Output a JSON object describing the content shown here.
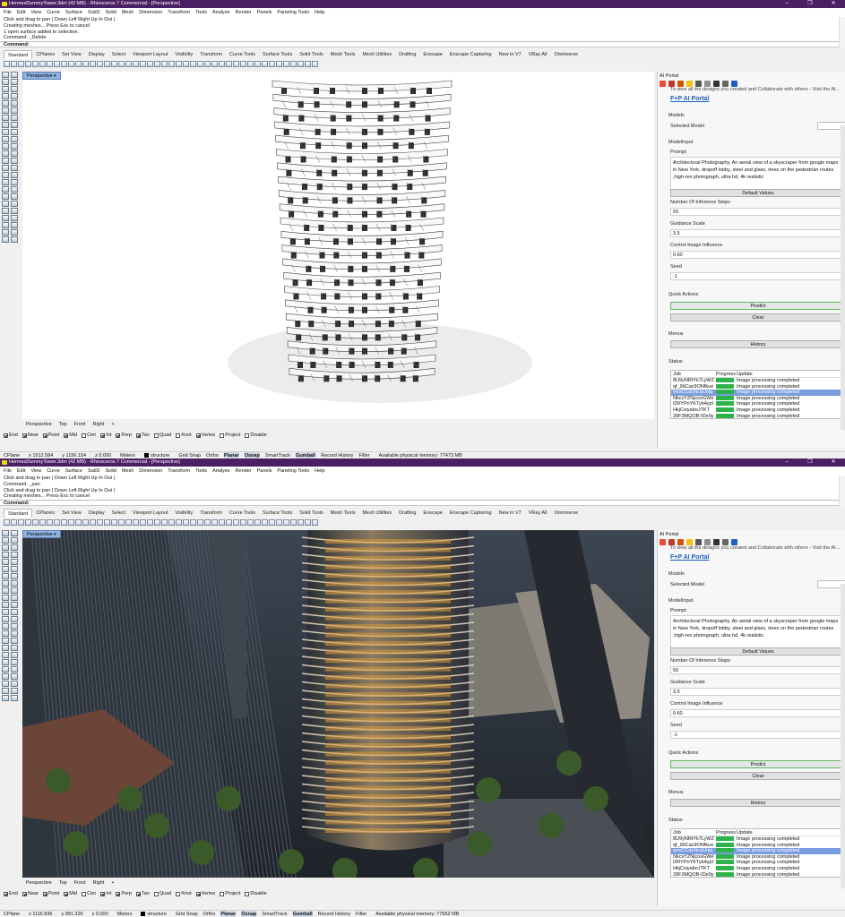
{
  "screens": [
    {
      "window_title": "HermesDummyTower.3dm (42 MB) - Rhinoceros 7 Commercial - [Perspective]",
      "command_history": [
        "Click and drag to pan ( Down  Left  Right  Up  In  Out )",
        "Creating meshes... Press Esc to cancel",
        "1 open surface added to selection.",
        "Command: _Delete"
      ],
      "command_prompt": "Command:",
      "viewport_label": "Perspective",
      "viewport_content": "wireframe",
      "status": {
        "cplane": "CPlane",
        "x": "x 1512.584",
        "y": "y 1156.154",
        "z": "z 0.000",
        "units": "Meters",
        "layer": "structure",
        "memory": "Available physical memory: 77473 MB"
      }
    },
    {
      "window_title": "HermesDummyTower.3dm (42 MB) - Rhinoceros 7 Commercial - [Perspective]",
      "command_history": [
        "Click and drag to pan ( Down  Left  Right  Up  In  Out )",
        "Command: _pan",
        "Click and drag to pan ( Down  Left  Right  Up  In  Out )",
        "Creating meshes... Press Esc to cancel"
      ],
      "command_prompt": "Command:",
      "viewport_label": "Perspective",
      "viewport_content": "render",
      "status": {
        "cplane": "CPlane",
        "x": "x 1116.836",
        "y": "y 991.326",
        "z": "z 0.000",
        "units": "Meters",
        "layer": "structure",
        "memory": "Available physical memory: 77552 MB"
      }
    }
  ],
  "menu": [
    "File",
    "Edit",
    "View",
    "Curve",
    "Surface",
    "SubD",
    "Solid",
    "Mesh",
    "Dimension",
    "Transform",
    "Tools",
    "Analyze",
    "Render",
    "Panels",
    "Paneling Tools",
    "Help"
  ],
  "toolbar_tabs": [
    "Standard",
    "CPlanes",
    "Set View",
    "Display",
    "Select",
    "Viewport Layout",
    "Visibility",
    "Transform",
    "Curve Tools",
    "Surface Tools",
    "Solid Tools",
    "Mesh Tools",
    "Mesh Utilities",
    "Drafting",
    "Enscape",
    "Enscape Capturing",
    "New in V7",
    "VRay All",
    "Omniverse"
  ],
  "view_tabs": [
    "Perspective",
    "Top",
    "Front",
    "Right",
    "+"
  ],
  "osnaps": [
    {
      "label": "End",
      "checked": true
    },
    {
      "label": "Near",
      "checked": true
    },
    {
      "label": "Point",
      "checked": true
    },
    {
      "label": "Mid",
      "checked": true
    },
    {
      "label": "Cen",
      "checked": false
    },
    {
      "label": "Int",
      "checked": true
    },
    {
      "label": "Perp",
      "checked": true
    },
    {
      "label": "Tan",
      "checked": true
    },
    {
      "label": "Quad",
      "checked": false
    },
    {
      "label": "Knot",
      "checked": false
    },
    {
      "label": "Vertex",
      "checked": true
    },
    {
      "label": "Project",
      "checked": false
    },
    {
      "label": "Disable",
      "checked": false
    }
  ],
  "status_toggles": [
    "Grid Snap",
    "Ortho",
    "Planar",
    "Osnap",
    "SmartTrack",
    "Gumball",
    "Record History",
    "Filter"
  ],
  "panel": {
    "title": "AI Portal",
    "info": "To view all the designs you created and Collaborate with others - Visit the AI...",
    "logo": "F+P AI Portal",
    "models_label": "Models",
    "selected_model_label": "Selected Model",
    "model_input_label": "ModelInput",
    "prompt_label": "Prompt",
    "prompt": "Architectural Photography, An aerial view of a skyscraper from google maps in New York, dropoff lobby, steel and glass, trees on the pedestrian routes ,high-res photograph, ultra hd, 4k realistic",
    "default_values_btn": "Default Values",
    "inference_steps_label": "Number Of Inference Steps",
    "inference_steps": "50",
    "guidance_label": "Guidance Scale",
    "guidance": "3.5",
    "control_label": "Control Image Influence",
    "control": "0.60",
    "seed_label": "Seed",
    "seed": "-1",
    "quick_actions_label": "Quick Actions",
    "predict_btn": "Predict",
    "clear_btn": "Clear",
    "menus_label": "Menus",
    "history_btn": "History",
    "status_label": "Status",
    "job_headers": [
      "Job",
      "Progress",
      "Update"
    ],
    "jobs": [
      {
        "job": "8U9yNRtYk7LyWZ",
        "update": "Image processing completed"
      },
      {
        "job": "qf_96Cac9ONfkue",
        "update": "Image processing completed"
      },
      {
        "job": "wxsCCdcNcaUnjq",
        "update": "Image processing completed"
      },
      {
        "job": "NkcsYZNjcosGWeVI",
        "update": "Image processing completed"
      },
      {
        "job": "l2RYPnYKTyb4ypl",
        "update": "Image processing completed"
      },
      {
        "job": "HkjCsiyaboJTKT",
        "update": "Image processing completed"
      },
      {
        "job": "28F3MQOB-IDe9y",
        "update": "Image processing completed"
      }
    ],
    "selected_job_index": 2
  }
}
